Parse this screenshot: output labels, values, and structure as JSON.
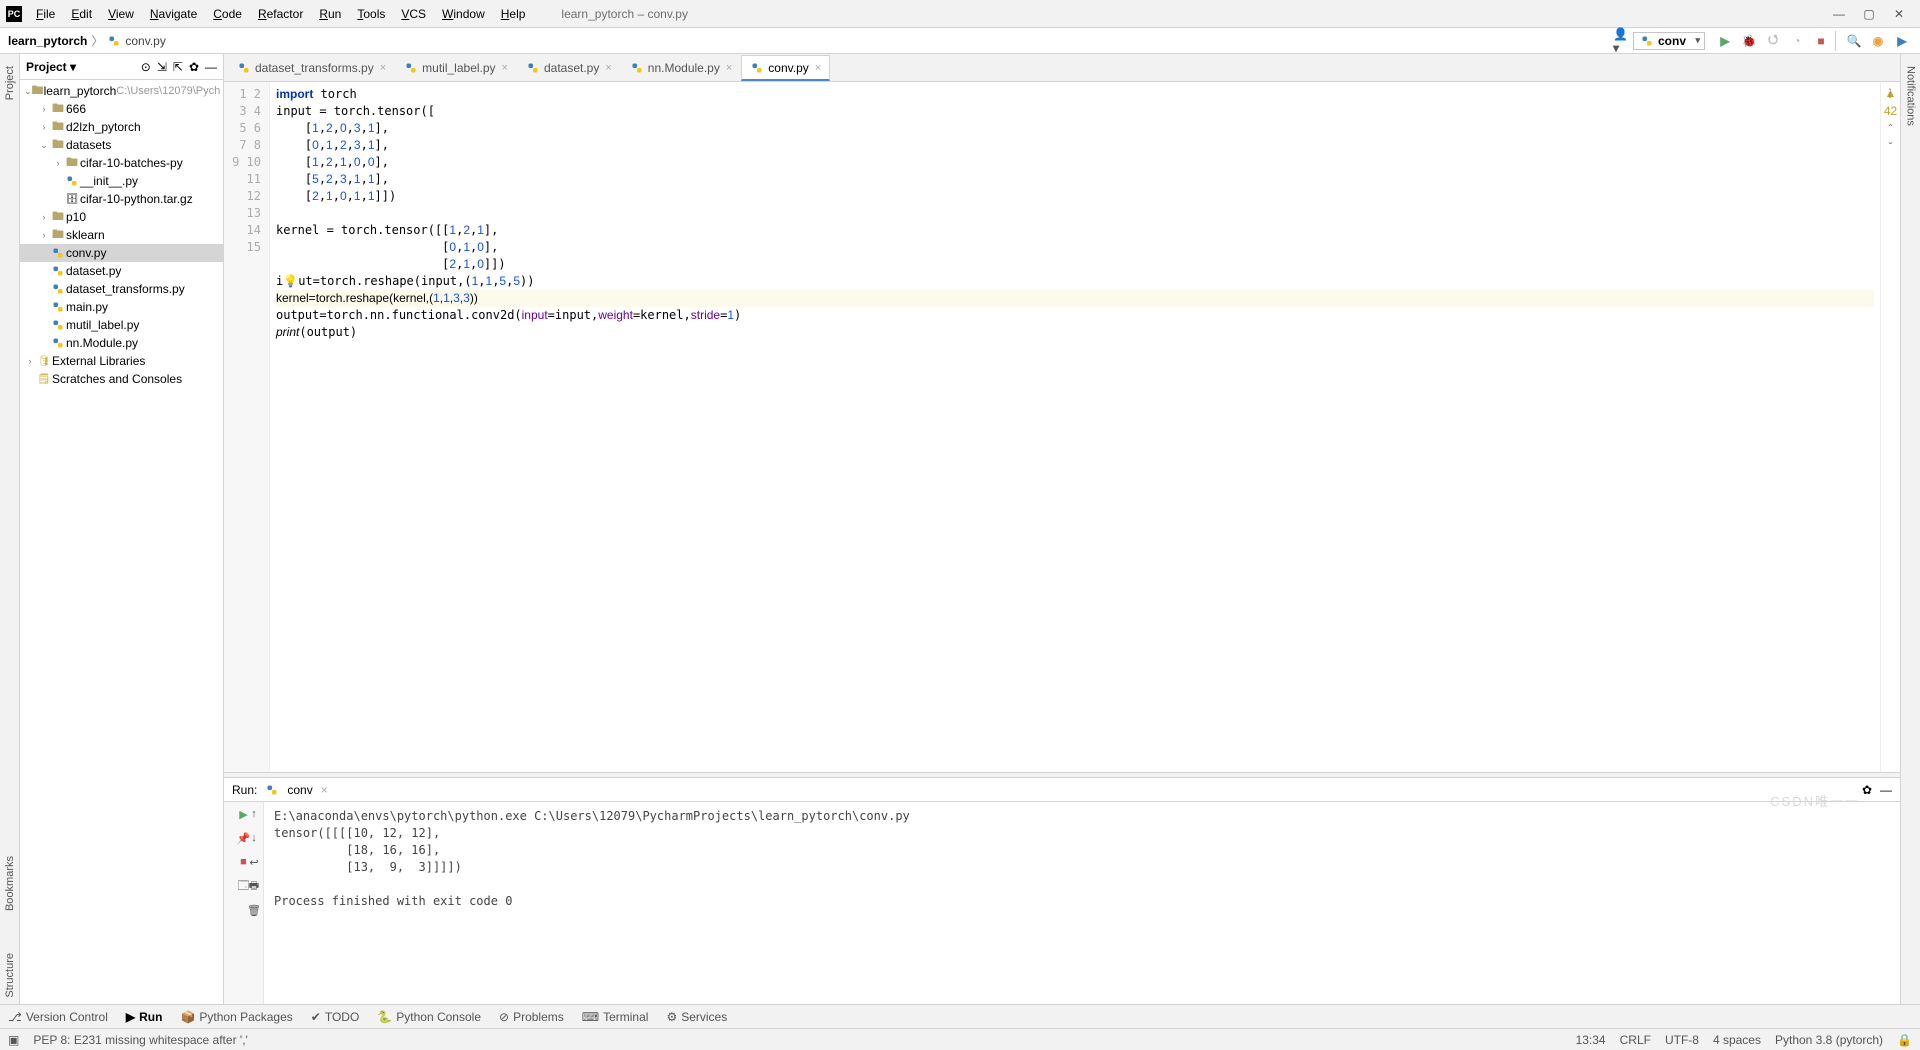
{
  "window": {
    "title": "learn_pytorch – conv.py"
  },
  "menu": [
    "File",
    "Edit",
    "View",
    "Navigate",
    "Code",
    "Refactor",
    "Run",
    "Tools",
    "VCS",
    "Window",
    "Help"
  ],
  "breadcrumb": {
    "project": "learn_pytorch",
    "file": "conv.py"
  },
  "run_config": "conv",
  "project_header": "Project",
  "tree": {
    "root": "learn_pytorch",
    "root_hint": "C:\\Users\\12079\\Pych",
    "items": [
      {
        "depth": 1,
        "exp": ">",
        "icon": "folder",
        "label": "666"
      },
      {
        "depth": 1,
        "exp": ">",
        "icon": "folder",
        "label": "d2lzh_pytorch"
      },
      {
        "depth": 1,
        "exp": "v",
        "icon": "folder",
        "label": "datasets"
      },
      {
        "depth": 2,
        "exp": ">",
        "icon": "folder",
        "label": "cifar-10-batches-py"
      },
      {
        "depth": 2,
        "exp": "",
        "icon": "py",
        "label": "__init__.py"
      },
      {
        "depth": 2,
        "exp": "",
        "icon": "archive",
        "label": "cifar-10-python.tar.gz"
      },
      {
        "depth": 1,
        "exp": ">",
        "icon": "folder",
        "label": "p10"
      },
      {
        "depth": 1,
        "exp": ">",
        "icon": "folder",
        "label": "sklearn"
      },
      {
        "depth": 1,
        "exp": "",
        "icon": "py",
        "label": "conv.py",
        "sel": true
      },
      {
        "depth": 1,
        "exp": "",
        "icon": "py",
        "label": "dataset.py"
      },
      {
        "depth": 1,
        "exp": "",
        "icon": "py",
        "label": "dataset_transforms.py"
      },
      {
        "depth": 1,
        "exp": "",
        "icon": "py",
        "label": "main.py"
      },
      {
        "depth": 1,
        "exp": "",
        "icon": "py",
        "label": "mutil_label.py"
      },
      {
        "depth": 1,
        "exp": "",
        "icon": "py",
        "label": "nn.Module.py"
      }
    ],
    "ext_lib": "External Libraries",
    "scratches": "Scratches and Consoles"
  },
  "tabs": [
    "dataset_transforms.py",
    "mutil_label.py",
    "dataset.py",
    "nn.Module.py",
    "conv.py"
  ],
  "active_tab": 4,
  "warnings": "42",
  "code_lines": 15,
  "code_html": "<span class='kw'>import</span> torch\ninput = torch.tensor([\n    [<span class='num'>1</span>,<span class='num'>2</span>,<span class='num'>0</span>,<span class='num'>3</span>,<span class='num'>1</span>],\n    [<span class='num'>0</span>,<span class='num'>1</span>,<span class='num'>2</span>,<span class='num'>3</span>,<span class='num'>1</span>],\n    [<span class='num'>1</span>,<span class='num'>2</span>,<span class='num'>1</span>,<span class='num'>0</span>,<span class='num'>0</span>],\n    [<span class='num'>5</span>,<span class='num'>2</span>,<span class='num'>3</span>,<span class='num'>1</span>,<span class='num'>1</span>],\n    [<span class='num'>2</span>,<span class='num'>1</span>,<span class='num'>0</span>,<span class='num'>1</span>,<span class='num'>1</span>]])\n\nkernel = torch.tensor([[<span class='num'>1</span>,<span class='num'>2</span>,<span class='num'>1</span>],\n                       [<span class='num'>0</span>,<span class='num'>1</span>,<span class='num'>0</span>],\n                       [<span class='num'>2</span>,<span class='num'>1</span>,<span class='num'>0</span>]])\ni<span class='bulb'>&#128161;</span>ut=torch.reshape(input,(<span class='num'>1</span>,<span class='num'>1</span>,<span class='num'>5</span>,<span class='num'>5</span>))\n<span class='hl-line'>kernel=torch.reshape(kernel,(<span class='num'>1</span>,<span class='num'>1</span>,<span class='num'>3</span>,<span class='num'>3</span>))</span>\noutput=torch.nn.functional.conv2d(<span class='arg'>input</span>=input,<span class='arg'>weight</span>=kernel,<span class='arg'>stride</span>=<span class='num'>1</span>)\n<span class='fn'>print</span>(output)",
  "run": {
    "label": "Run:",
    "name": "conv",
    "console": "E:\\anaconda\\envs\\pytorch\\python.exe C:\\Users\\12079\\PycharmProjects\\learn_pytorch\\conv.py\ntensor([[[[10, 12, 12],\n          [18, 16, 16],\n          [13,  9,  3]]]])\n\nProcess finished with exit code 0"
  },
  "bottom_tabs": [
    "Version Control",
    "Run",
    "Python Packages",
    "TODO",
    "Python Console",
    "Problems",
    "Terminal",
    "Services"
  ],
  "status": {
    "msg": "PEP 8: E231 missing whitespace after ','",
    "pos": "13:34",
    "sep": "CRLF",
    "enc": "UTF-8",
    "indent": "4 spaces",
    "interp": "Python 3.8 (pytorch)"
  }
}
